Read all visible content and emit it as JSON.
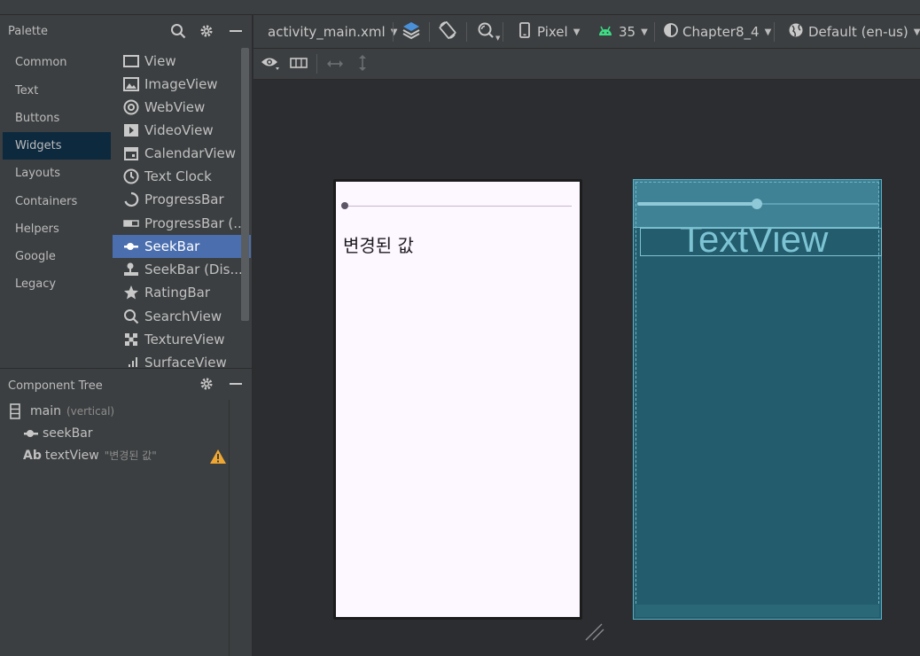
{
  "palette": {
    "title": "Palette",
    "categories": [
      "Common",
      "Text",
      "Buttons",
      "Widgets",
      "Layouts",
      "Containers",
      "Helpers",
      "Google",
      "Legacy"
    ],
    "selected_category": "Widgets",
    "widgets": [
      {
        "label": "View",
        "icon": "view-icon"
      },
      {
        "label": "ImageView",
        "icon": "image-icon"
      },
      {
        "label": "WebView",
        "icon": "globe-icon"
      },
      {
        "label": "VideoView",
        "icon": "play-icon"
      },
      {
        "label": "CalendarView",
        "icon": "calendar-icon"
      },
      {
        "label": "Text Clock",
        "icon": "clock-icon"
      },
      {
        "label": "ProgressBar",
        "icon": "progress-circle-icon"
      },
      {
        "label": "ProgressBar (...",
        "icon": "progress-bar-icon"
      },
      {
        "label": "SeekBar",
        "icon": "seekbar-icon"
      },
      {
        "label": "SeekBar (Dis...",
        "icon": "seekbar-discrete-icon"
      },
      {
        "label": "RatingBar",
        "icon": "star-icon"
      },
      {
        "label": "SearchView",
        "icon": "search-icon"
      },
      {
        "label": "TextureView",
        "icon": "texture-icon"
      },
      {
        "label": "SurfaceView",
        "icon": "surface-icon"
      }
    ],
    "selected_widget": "SeekBar"
  },
  "component_tree": {
    "title": "Component Tree",
    "root": {
      "label": "main",
      "note": "(vertical)"
    },
    "children": [
      {
        "label": "seekBar",
        "note": ""
      },
      {
        "label": "textView",
        "note": "\"변경된 값\"",
        "badge": "Ab"
      }
    ]
  },
  "toolbar": {
    "file": "activity_main.xml",
    "device": "Pixel",
    "api": "35",
    "theme": "Chapter8_4",
    "locale": "Default (en-us)"
  },
  "preview": {
    "text": "변경된 값",
    "seek_progress": 0
  },
  "blueprint": {
    "text": "TextView",
    "seek_progress": 0.5
  },
  "colors": {
    "panel": "#3c3f41",
    "selected_widget": "#4b6eaf",
    "selected_category": "#0d293e",
    "blueprint": "#235c6d",
    "warning": "#f0a732",
    "android_green": "#3ddc84"
  }
}
